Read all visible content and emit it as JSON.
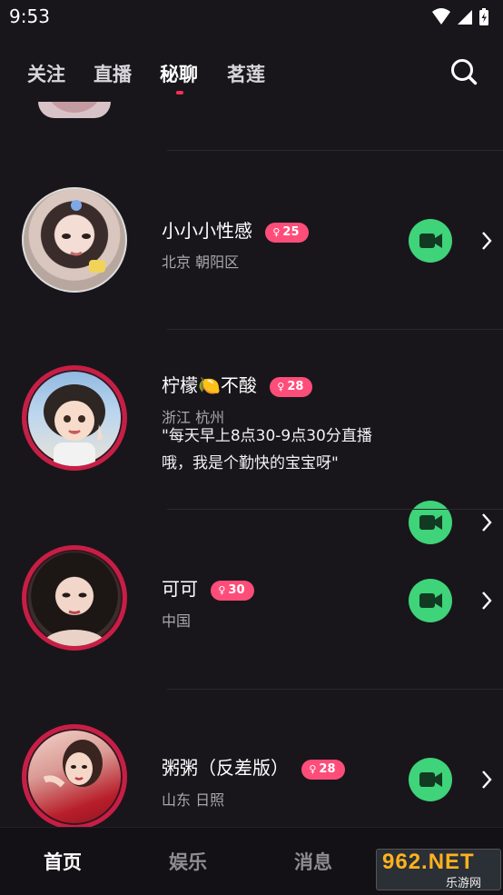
{
  "status": {
    "time": "9:53"
  },
  "tabs": [
    {
      "label": "关注"
    },
    {
      "label": "直播"
    },
    {
      "label": "秘聊"
    },
    {
      "label": "茗莲"
    }
  ],
  "active_tab": "秘聊",
  "users": [
    {
      "name": "小小小性感",
      "age": "25",
      "location": "北京 朝阳区",
      "bio": ""
    },
    {
      "name": "柠檬🍋不酸",
      "age": "28",
      "location": "浙江 杭州",
      "bio": "\"每天早上8点30-9点30分直播哦，我是个勤快的宝宝呀\""
    },
    {
      "name": "可可",
      "age": "30",
      "location": "中国",
      "bio": ""
    },
    {
      "name": "粥粥（反差版）",
      "age": "28",
      "location": "山东 日照",
      "bio": ""
    }
  ],
  "badge_symbol": "♀",
  "bottom_nav": [
    {
      "label": "首页"
    },
    {
      "label": "娱乐"
    },
    {
      "label": "消息"
    }
  ],
  "watermark": {
    "main": "962.NET",
    "sub": "乐游网"
  },
  "colors": {
    "background": "#18161b",
    "badge": "#ff4d7a",
    "video_button": "#3fd37a",
    "avatar_ring": "#c81e45",
    "tab_indicator": "#ff2d55"
  },
  "icons": {
    "search": "search-icon",
    "video": "video-camera-icon",
    "chevron": "chevron-right-icon",
    "wifi": "wifi-icon",
    "signal": "signal-icon",
    "battery": "battery-icon"
  }
}
